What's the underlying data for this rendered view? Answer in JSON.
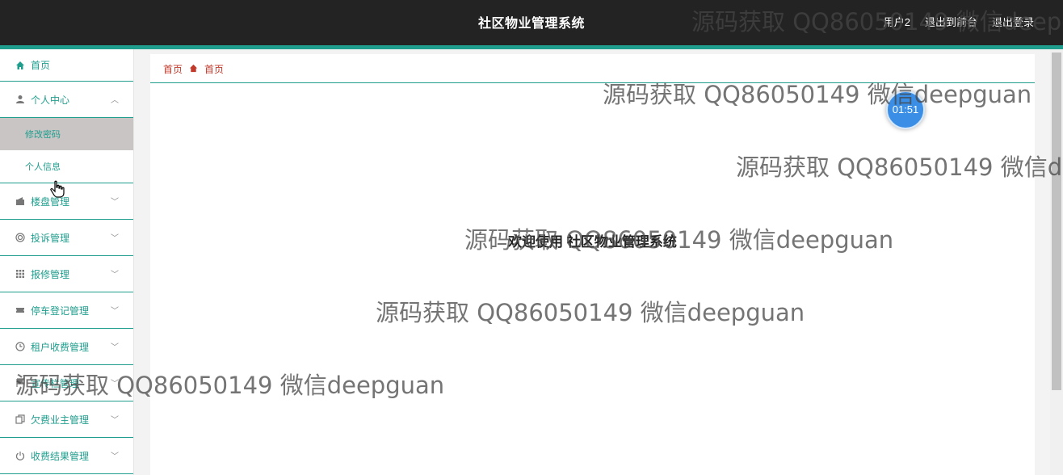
{
  "header": {
    "title": "社区物业管理系统",
    "user": "用户2",
    "exit_front": "退出到前台",
    "logout": "退出登录"
  },
  "sidebar": {
    "home": "首页",
    "personal_center": "个人中心",
    "sub_items": [
      "修改密码",
      "个人信息"
    ],
    "items": [
      {
        "label": "楼盘管理",
        "icon": "wallet-icon"
      },
      {
        "label": "投诉管理",
        "icon": "target-icon"
      },
      {
        "label": "报修管理",
        "icon": "grid-icon"
      },
      {
        "label": "停车登记管理",
        "icon": "ticket-icon"
      },
      {
        "label": "租户收费管理",
        "icon": "clock-icon"
      },
      {
        "label": "宣传栏管理",
        "icon": "flag-icon"
      },
      {
        "label": "欠费业主管理",
        "icon": "copy-icon"
      },
      {
        "label": "收费结果管理",
        "icon": "power-icon"
      }
    ]
  },
  "breadcrumb": {
    "root": "首页",
    "current": "首页"
  },
  "welcome": "欢迎使用 社区物业管理系统",
  "timer": "01:51",
  "watermark": "源码获取 QQ86050149 微信deepguan",
  "colors": {
    "accent": "#1f9e8d",
    "header_bg": "#232323",
    "breadcrumb": "#c0392b"
  }
}
